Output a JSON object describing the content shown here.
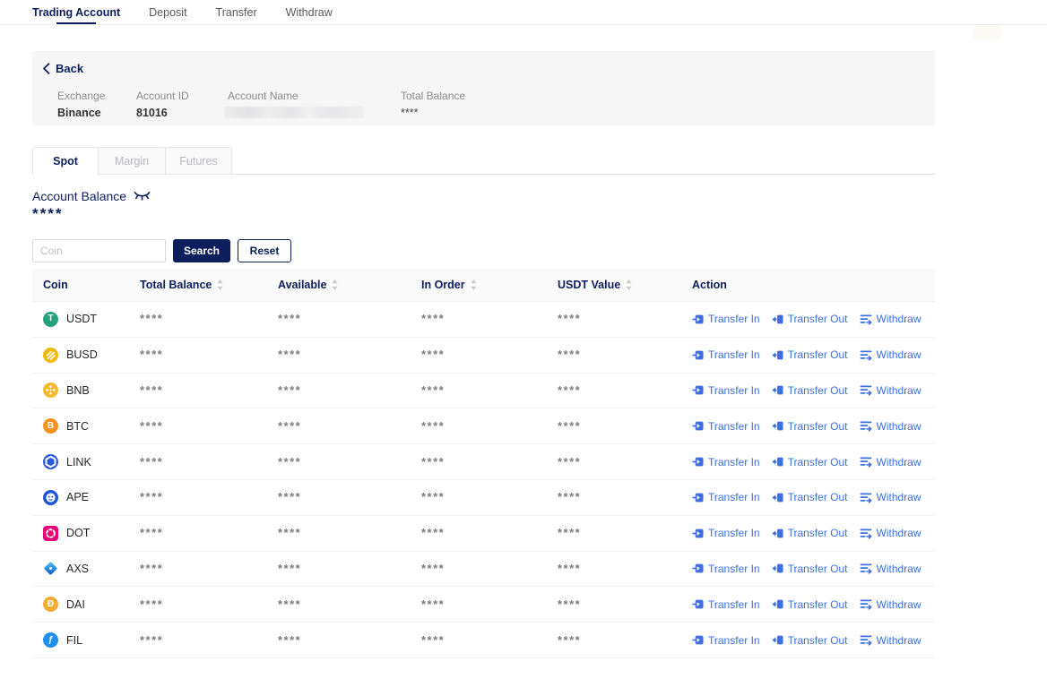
{
  "colors": {
    "brand_navy": "#0d1e5c",
    "link_blue": "#3d6fe0"
  },
  "nav": {
    "items": [
      {
        "label": "Trading Account",
        "active": true
      },
      {
        "label": "Deposit",
        "active": false
      },
      {
        "label": "Transfer",
        "active": false
      },
      {
        "label": "Withdraw",
        "active": false
      }
    ]
  },
  "account_header": {
    "back_label": "Back",
    "fields": [
      {
        "label": "Exchange",
        "value": "Binance",
        "bold": true,
        "redacted": false
      },
      {
        "label": "Account ID",
        "value": "81016",
        "bold": true,
        "redacted": false
      },
      {
        "label": "Account Name",
        "value": "",
        "bold": false,
        "redacted": true
      },
      {
        "label": "Total Balance",
        "value": "****",
        "bold": false,
        "redacted": false
      }
    ]
  },
  "tabs": [
    {
      "label": "Spot",
      "state": "active"
    },
    {
      "label": "Margin",
      "state": "disabled"
    },
    {
      "label": "Futures",
      "state": "disabled"
    }
  ],
  "balance_section": {
    "label": "Account Balance",
    "masked_value": "****"
  },
  "search": {
    "placeholder": "Coin",
    "search_label": "Search",
    "reset_label": "Reset"
  },
  "icons": {
    "back": "chevron-left-icon",
    "balance_visibility": "eye-closed-icon",
    "sort": "sort-carets-icon",
    "transfer_in": "transfer-in-icon",
    "transfer_out": "transfer-out-icon",
    "withdraw": "withdraw-icon"
  },
  "table": {
    "columns": [
      {
        "label": "Coin",
        "sortable": false
      },
      {
        "label": "Total Balance",
        "sortable": true
      },
      {
        "label": "Available",
        "sortable": true
      },
      {
        "label": "In Order",
        "sortable": true
      },
      {
        "label": "USDT Value",
        "sortable": true
      },
      {
        "label": "Action",
        "sortable": false
      }
    ],
    "masked_value": "****",
    "actions": [
      {
        "label": "Transfer In",
        "icon": "transfer-in-icon"
      },
      {
        "label": "Transfer Out",
        "icon": "transfer-out-icon"
      },
      {
        "label": "Withdraw",
        "icon": "withdraw-icon"
      }
    ],
    "rows": [
      {
        "coin": "USDT",
        "icon": {
          "style": "circle",
          "bg": "#26A17B",
          "glyph": "T"
        }
      },
      {
        "coin": "BUSD",
        "icon": {
          "style": "busd",
          "bg": "#F0B90B"
        }
      },
      {
        "coin": "BNB",
        "icon": {
          "style": "bnb",
          "bg": "#F3BA2F"
        }
      },
      {
        "coin": "BTC",
        "icon": {
          "style": "circle",
          "bg": "#F7931A",
          "glyph": "B"
        }
      },
      {
        "coin": "LINK",
        "icon": {
          "style": "link",
          "bg": "#2A5ADA"
        }
      },
      {
        "coin": "APE",
        "icon": {
          "style": "ape",
          "bg": "#1A56D6"
        }
      },
      {
        "coin": "DOT",
        "icon": {
          "style": "dot",
          "bg": "#E6007A"
        }
      },
      {
        "coin": "AXS",
        "icon": {
          "style": "axs",
          "bg": "#1781E8"
        }
      },
      {
        "coin": "DAI",
        "icon": {
          "style": "circle",
          "bg": "#F5AC37",
          "glyph": "Ð"
        }
      },
      {
        "coin": "FIL",
        "icon": {
          "style": "circle",
          "bg": "#1F8FF0",
          "glyph": "ƒ"
        }
      }
    ]
  }
}
